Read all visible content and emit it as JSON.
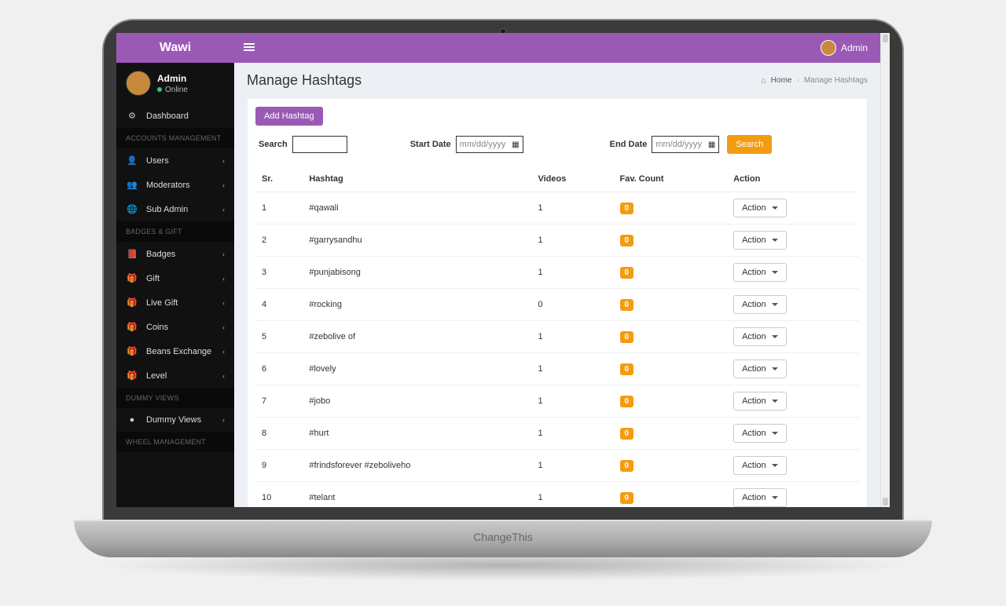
{
  "laptop_hinge_text": "ChangeThis",
  "topbar": {
    "brand": "Wawi",
    "user_label": "Admin"
  },
  "sidebar": {
    "user_name": "Admin",
    "user_status": "Online",
    "nav": [
      {
        "kind": "item",
        "icon": "⚙",
        "label": "Dashboard",
        "expandable": false
      },
      {
        "kind": "header",
        "label": "ACCOUNTS MANAGEMENT"
      },
      {
        "kind": "item",
        "icon": "👤",
        "label": "Users",
        "expandable": true
      },
      {
        "kind": "item",
        "icon": "👥",
        "label": "Moderators",
        "expandable": true
      },
      {
        "kind": "item",
        "icon": "🌐",
        "label": "Sub Admin",
        "expandable": true
      },
      {
        "kind": "header",
        "label": "BADGES & GIFT"
      },
      {
        "kind": "item",
        "icon": "📕",
        "label": "Badges",
        "expandable": true
      },
      {
        "kind": "item",
        "icon": "🎁",
        "label": "Gift",
        "expandable": true
      },
      {
        "kind": "item",
        "icon": "🎁",
        "label": "Live Gift",
        "expandable": true
      },
      {
        "kind": "item",
        "icon": "🎁",
        "label": "Coins",
        "expandable": true
      },
      {
        "kind": "item",
        "icon": "🎁",
        "label": "Beans Exchange",
        "expandable": true
      },
      {
        "kind": "item",
        "icon": "🎁",
        "label": "Level",
        "expandable": true
      },
      {
        "kind": "header",
        "label": "Dummy Views"
      },
      {
        "kind": "item",
        "icon": "●",
        "label": "Dummy Views",
        "expandable": true
      },
      {
        "kind": "header",
        "label": "WHEEL MANAGEMENT"
      }
    ]
  },
  "page": {
    "title": "Manage Hashtags",
    "breadcrumb_home": "Home",
    "breadcrumb_current": "Manage Hashtags",
    "add_button": "Add Hashtag",
    "filters": {
      "search_label": "Search",
      "start_date_label": "Start Date",
      "end_date_label": "End Date",
      "date_placeholder": "mm/dd/yyyy",
      "search_button": "Search"
    },
    "table": {
      "columns": [
        "Sr.",
        "Hashtag",
        "Videos",
        "Fav. Count",
        "Action"
      ],
      "action_label": "Action",
      "rows": [
        {
          "sr": "1",
          "hashtag": "#qawali",
          "videos": "1",
          "fav": "0"
        },
        {
          "sr": "2",
          "hashtag": "#garrysandhu",
          "videos": "1",
          "fav": "0"
        },
        {
          "sr": "3",
          "hashtag": "#punjabisong",
          "videos": "1",
          "fav": "0"
        },
        {
          "sr": "4",
          "hashtag": "#rocking",
          "videos": "0",
          "fav": "0"
        },
        {
          "sr": "5",
          "hashtag": "#zebolive of",
          "videos": "1",
          "fav": "0"
        },
        {
          "sr": "6",
          "hashtag": "#lovely",
          "videos": "1",
          "fav": "0"
        },
        {
          "sr": "7",
          "hashtag": "#jobo",
          "videos": "1",
          "fav": "0"
        },
        {
          "sr": "8",
          "hashtag": "#hurt",
          "videos": "1",
          "fav": "0"
        },
        {
          "sr": "9",
          "hashtag": "#frindsforever #zeboliveho",
          "videos": "1",
          "fav": "0"
        },
        {
          "sr": "10",
          "hashtag": "#telant",
          "videos": "1",
          "fav": "0"
        }
      ]
    }
  }
}
